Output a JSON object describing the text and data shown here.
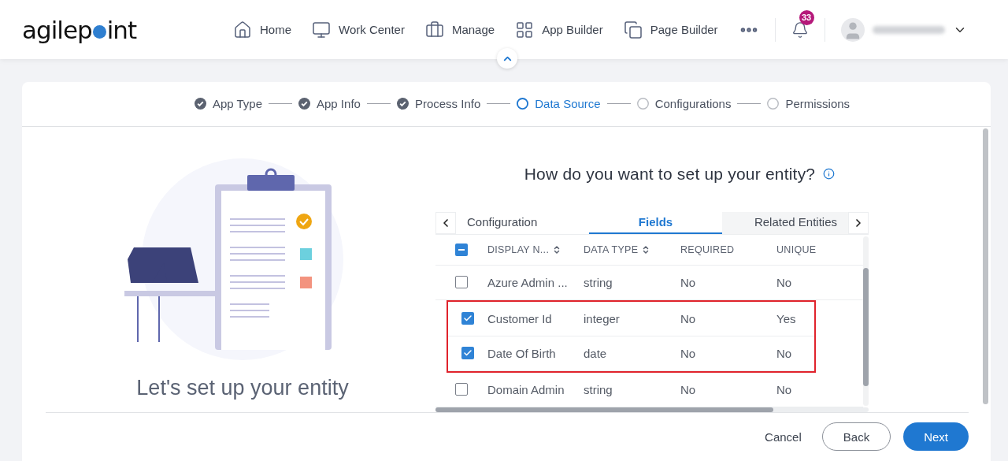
{
  "logo": {
    "text_before": "agilep",
    "text_after": "int"
  },
  "nav": [
    {
      "label": "Home"
    },
    {
      "label": "Work Center"
    },
    {
      "label": "Manage"
    },
    {
      "label": "App Builder"
    },
    {
      "label": "Page Builder"
    }
  ],
  "notifications": {
    "count": "33"
  },
  "steps": [
    {
      "label": "App Type",
      "completed": true,
      "selected": false
    },
    {
      "label": "App Info",
      "completed": true,
      "selected": false
    },
    {
      "label": "Process Info",
      "completed": true,
      "selected": false
    },
    {
      "label": "Data Source",
      "completed": false,
      "selected": true
    },
    {
      "label": "Configurations",
      "completed": false,
      "selected": false
    },
    {
      "label": "Permissions",
      "completed": false,
      "selected": false
    }
  ],
  "illustration_caption": "Let's set up your entity",
  "question": "How do you want to set up your entity?",
  "tabs": [
    {
      "label": "Configuration",
      "selected": false
    },
    {
      "label": "Fields",
      "selected": true
    },
    {
      "label": "Related Entities",
      "selected": false
    }
  ],
  "table": {
    "select_all": {
      "checked": true,
      "indeterminate": true
    },
    "columns": [
      {
        "label": "DISPLAY N...",
        "sortable": true
      },
      {
        "label": "DATA TYPE",
        "sortable": true
      },
      {
        "label": "REQUIRED",
        "sortable": false
      },
      {
        "label": "UNIQUE",
        "sortable": false
      }
    ],
    "rows": [
      {
        "checked": false,
        "highlighted": false,
        "cells": [
          "Azure Admin ...",
          "string",
          "No",
          "No"
        ]
      },
      {
        "checked": true,
        "highlighted": true,
        "cells": [
          "Customer Id",
          "integer",
          "No",
          "Yes"
        ]
      },
      {
        "checked": true,
        "highlighted": true,
        "cells": [
          "Date Of Birth",
          "date",
          "No",
          "No"
        ]
      },
      {
        "checked": false,
        "highlighted": false,
        "cells": [
          "Domain Admin",
          "string",
          "No",
          "No"
        ]
      }
    ]
  },
  "buttons": [
    {
      "label": "Cancel",
      "kind": "link"
    },
    {
      "label": "Back",
      "kind": "outline"
    },
    {
      "label": "Next",
      "kind": "primary"
    }
  ]
}
